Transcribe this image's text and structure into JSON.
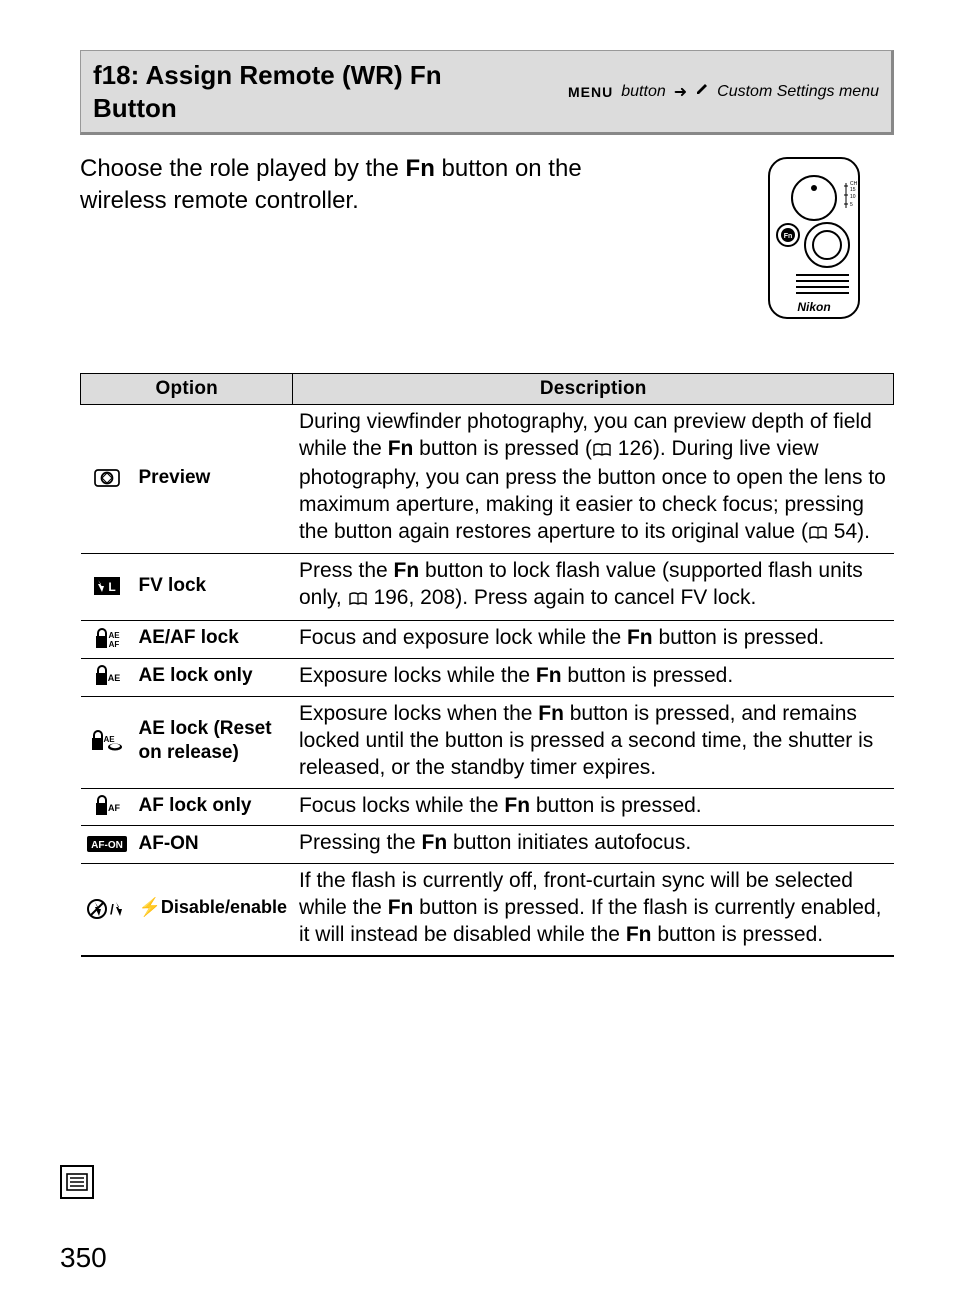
{
  "header": {
    "title": "f18: Assign Remote (WR) Fn Button",
    "breadcrumb_menu": "MENU",
    "breadcrumb_button": "button",
    "breadcrumb_dest": "Custom Settings menu"
  },
  "intro": {
    "pre": "Choose the role played by the ",
    "fn": "Fn",
    "post": " button on the wireless remote controller."
  },
  "remote_brand": "Nikon",
  "table": {
    "head_option": "Option",
    "head_desc": "Description"
  },
  "rows": {
    "preview": {
      "label": "Preview",
      "d1": "During viewfinder photography, you can preview depth of field while the ",
      "d_fn": "Fn",
      "d2": " button is pressed (",
      "d_ref1": "126",
      "d3": "). During live view photography, you can press the button once to open the lens to maximum aperture, making it easier to check focus; pressing the button again restores aperture to its original value (",
      "d_ref2": "54",
      "d4": ")."
    },
    "fvlock": {
      "label": "FV lock",
      "d1": "Press the ",
      "d_fn": "Fn",
      "d2": " button to lock flash value (supported flash units only, ",
      "d_ref1": "196, 208",
      "d3": ").  Press again to cancel FV lock."
    },
    "aeaf": {
      "label": "AE/AF lock",
      "d1": "Focus and exposure lock while the ",
      "d_fn": "Fn",
      "d2": " button is pressed."
    },
    "aeonly": {
      "label": "AE lock only",
      "d1": "Exposure locks while the ",
      "d_fn": "Fn",
      "d2": " button is pressed."
    },
    "aereset": {
      "label": "AE lock (Reset on release)",
      "d1": "Exposure locks when the ",
      "d_fn": "Fn",
      "d2": " button is pressed, and remains locked until the button is pressed a second time, the shutter is released, or the standby timer expires."
    },
    "afonly": {
      "label": "AF lock only",
      "d1": "Focus locks while the ",
      "d_fn": "Fn",
      "d2": " button is pressed."
    },
    "afon": {
      "label": "AF-ON",
      "d1": "Pressing the ",
      "d_fn": "Fn",
      "d2": " button initiates autofocus."
    },
    "flashde": {
      "label_pre": "⚡Disable/enable",
      "d1": "If the flash is currently off, front-curtain sync will be selected while the ",
      "d_fn": "Fn",
      "d2": " button is pressed.  If the flash is currently enabled, it will instead be disabled while the ",
      "d_fn2": "Fn",
      "d3": " button is pressed."
    }
  },
  "page_number": "350"
}
